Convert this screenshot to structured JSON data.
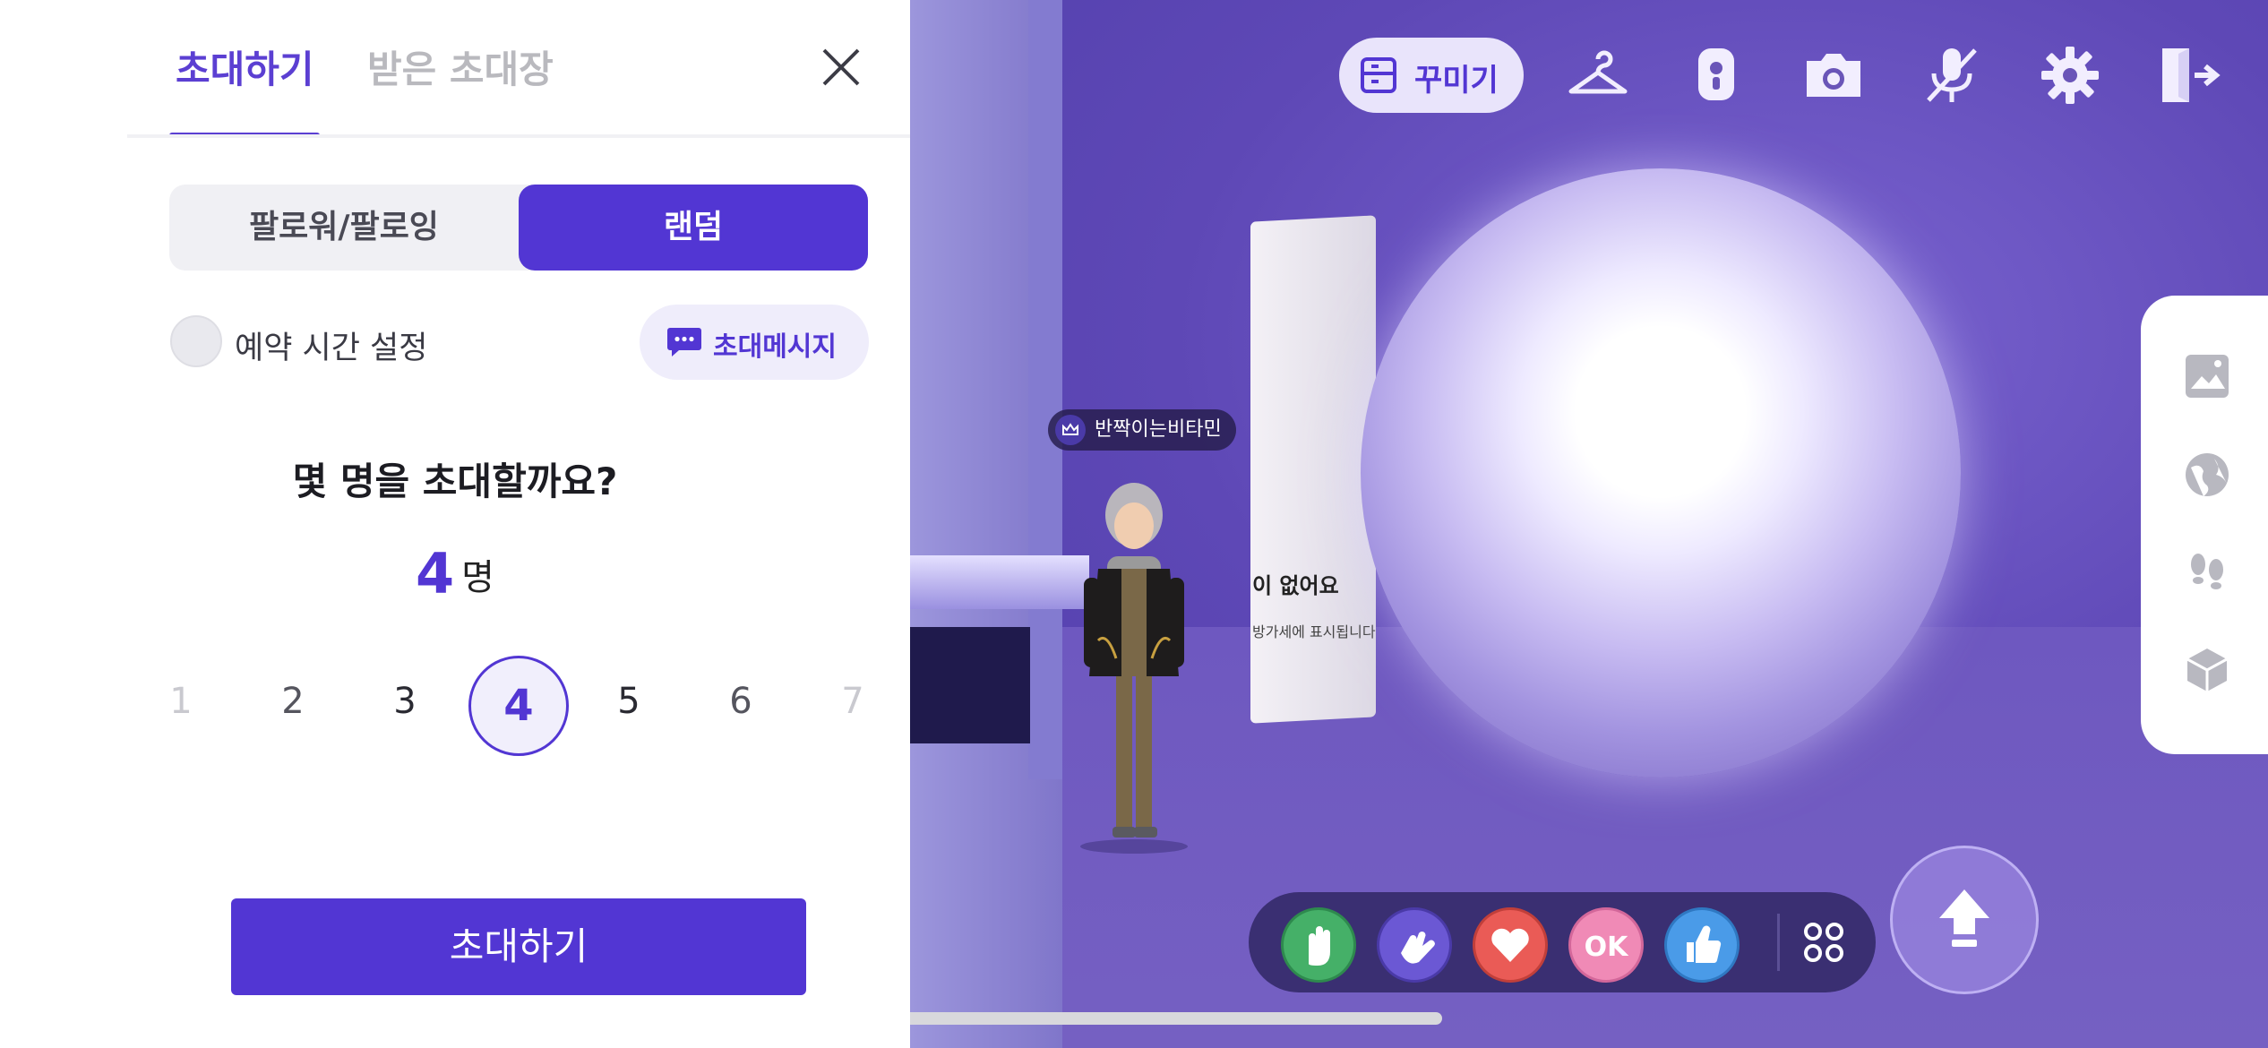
{
  "invite_panel": {
    "tabs": [
      {
        "label": "초대하기",
        "selected": true
      },
      {
        "label": "받은 초대장",
        "selected": false
      }
    ],
    "close_icon": "close-icon",
    "segment": {
      "options": [
        "팔로워/팔로잉",
        "랜덤"
      ],
      "selected": "랜덤"
    },
    "reserve_time_label": "예약 시간 설정",
    "reserve_time_on": false,
    "invite_message_label": "초대메시지",
    "question": "몇 명을 초대할까요?",
    "count": "4",
    "count_unit": "명",
    "number_picker": [
      "1",
      "2",
      "3",
      "4",
      "5",
      "6",
      "7"
    ],
    "selected_number": "4",
    "invite_button_label": "초대하기"
  },
  "scene": {
    "player_name": "반짝이는비타민",
    "poster_text_1": "이 없어요",
    "poster_text_2": "방가세에 표시됩니다"
  },
  "toolbar": {
    "decorate_label": "꾸미기",
    "icons": [
      "hanger-icon",
      "badge-icon",
      "camera-icon",
      "mic-off-icon",
      "gear-icon",
      "exit-icon"
    ]
  },
  "side_panel": {
    "icons": [
      "gallery-icon",
      "globe-icon",
      "footprints-icon",
      "cube-icon"
    ]
  },
  "emotes": [
    "raise-hand-icon",
    "wave-icon",
    "heart-icon",
    "ok-icon",
    "thumbs-up-icon"
  ],
  "colors": {
    "accent": "#5236d3",
    "panel_bg": "#ffffff",
    "scene_bg": "#6a55b8",
    "emote_bar": "#3a2f72"
  }
}
